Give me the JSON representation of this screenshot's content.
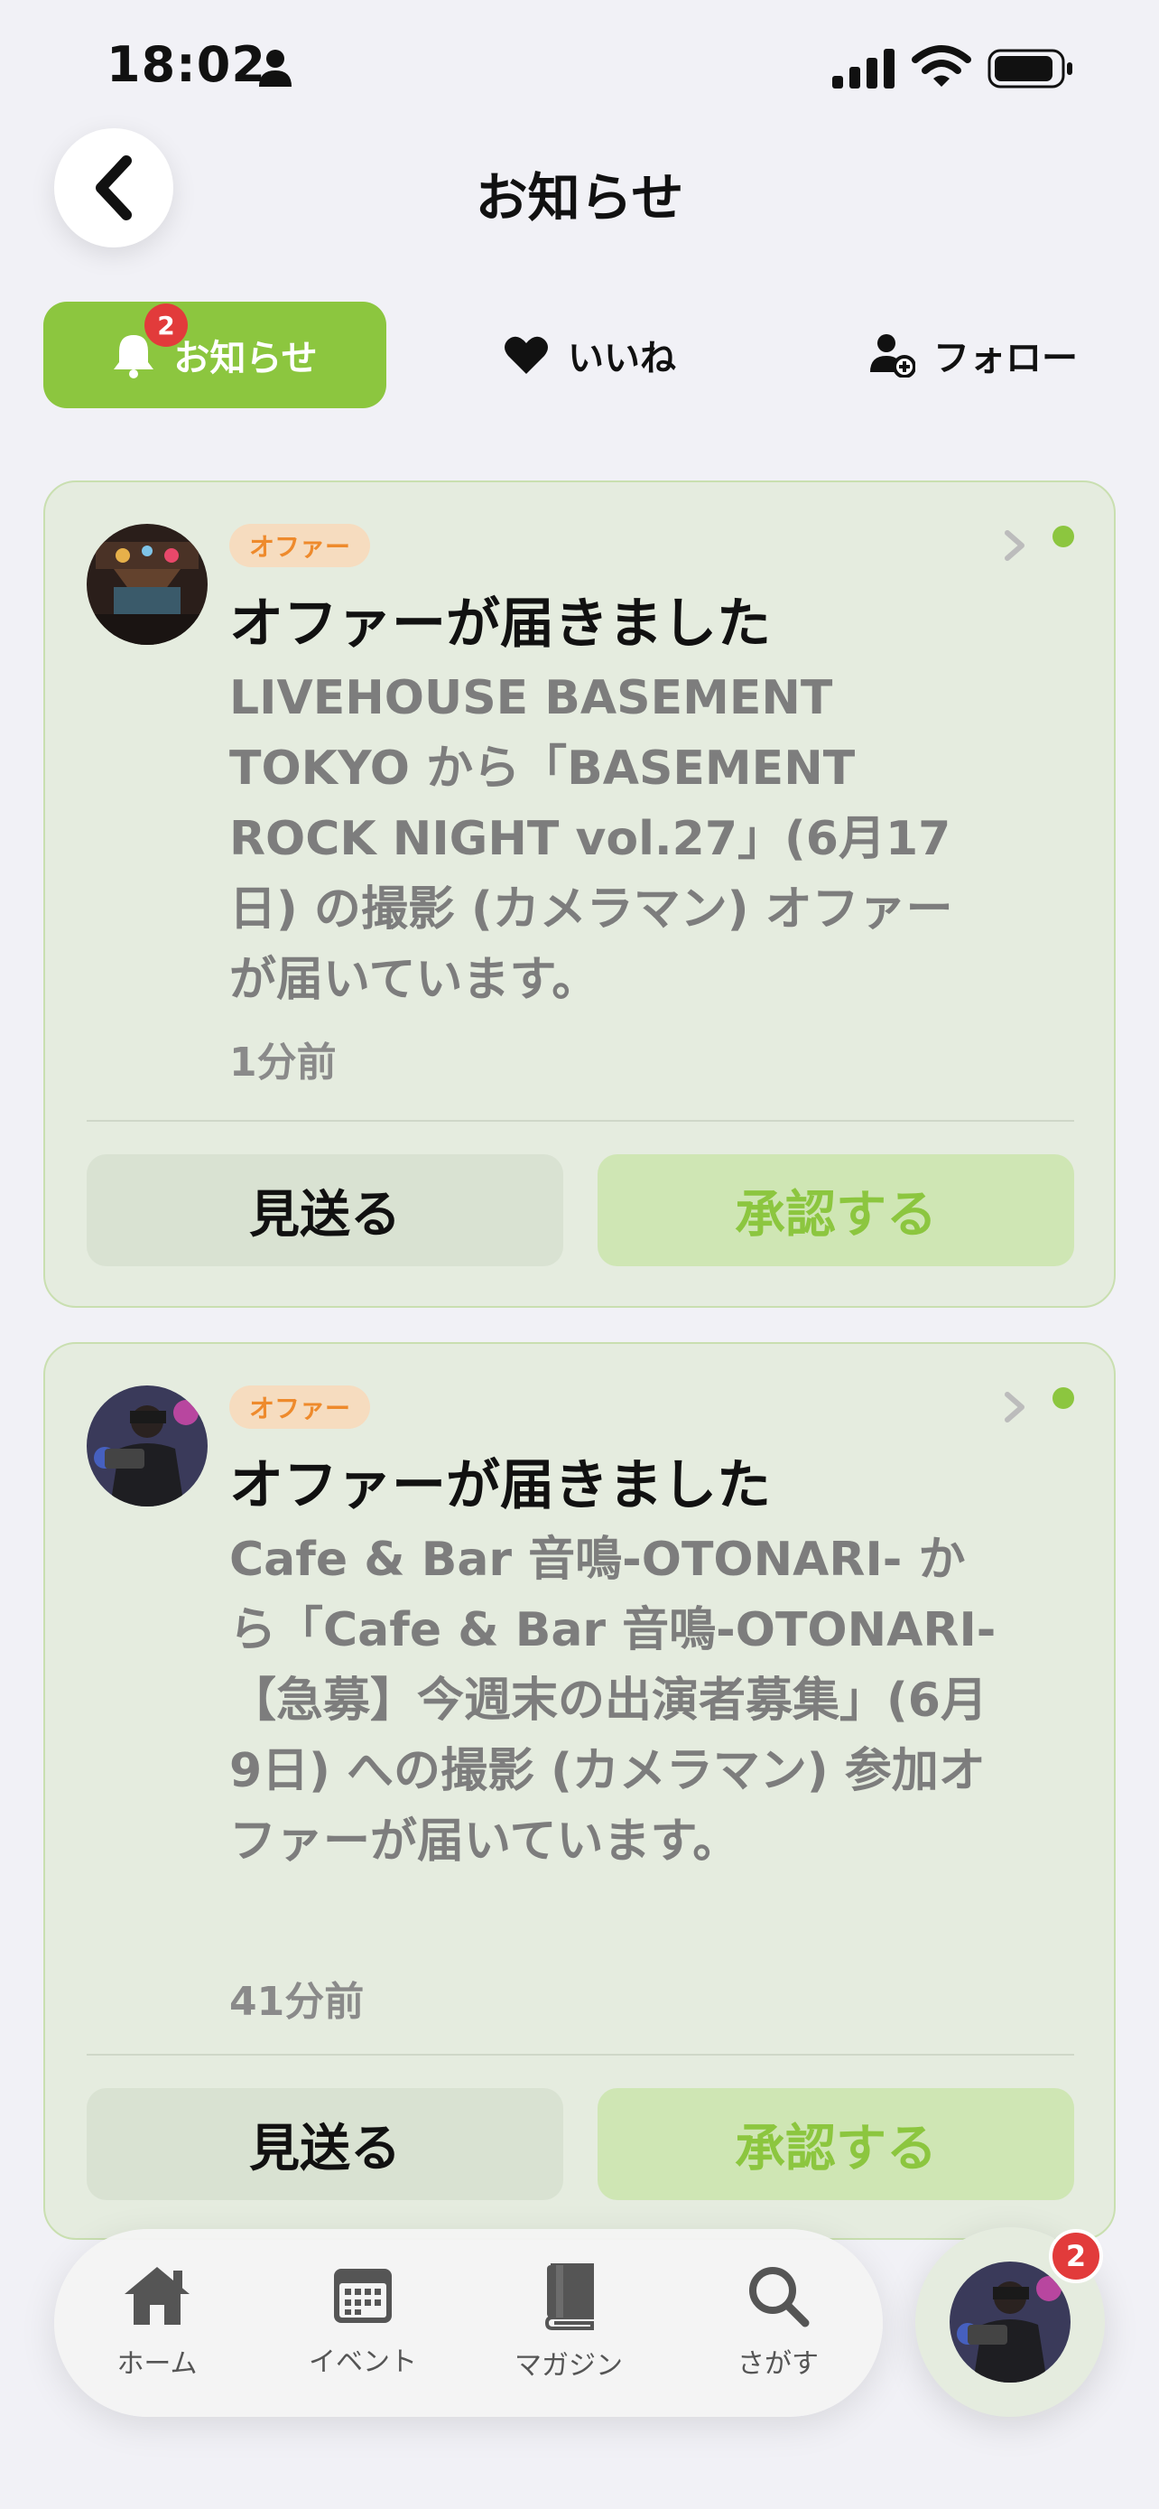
{
  "status_bar": {
    "time": "18:02"
  },
  "header": {
    "title": "お知らせ"
  },
  "tabs": [
    {
      "label": "お知らせ",
      "badge": "2",
      "active": true
    },
    {
      "label": "いいね"
    },
    {
      "label": "フォロー"
    }
  ],
  "notifications": [
    {
      "tag": "オファー",
      "title": "オファーが届きました",
      "body": "LIVEHOUSE BASEMENT TOKYO から「BASEMENT ROCK NIGHT vol.27」(6月17日) の撮影 (カメラマン) オファーが届いています。",
      "time": "1分前",
      "skip_label": "見送る",
      "approve_label": "承認する"
    },
    {
      "tag": "オファー",
      "title": "オファーが届きました",
      "body": "Cafe & Bar 音鳴-OTONARI- から「Cafe & Bar 音鳴-OTONARI-【急募】今週末の出演者募集」(6月9日) への撮影 (カメラマン) 参加オファーが届いています。",
      "time": "41分前",
      "skip_label": "見送る",
      "approve_label": "承認する"
    }
  ],
  "bottom_nav": {
    "items": [
      {
        "label": "ホーム",
        "icon": "home-icon"
      },
      {
        "label": "イベント",
        "icon": "calendar-icon"
      },
      {
        "label": "マガジン",
        "icon": "book-icon"
      },
      {
        "label": "さがす",
        "icon": "search-icon"
      }
    ]
  },
  "profile": {
    "badge": "2"
  },
  "colors": {
    "accent": "#8cc63f",
    "badge": "#e23b3b",
    "tag_text": "#ee8a2c",
    "card_bg": "#e5ecdf"
  }
}
